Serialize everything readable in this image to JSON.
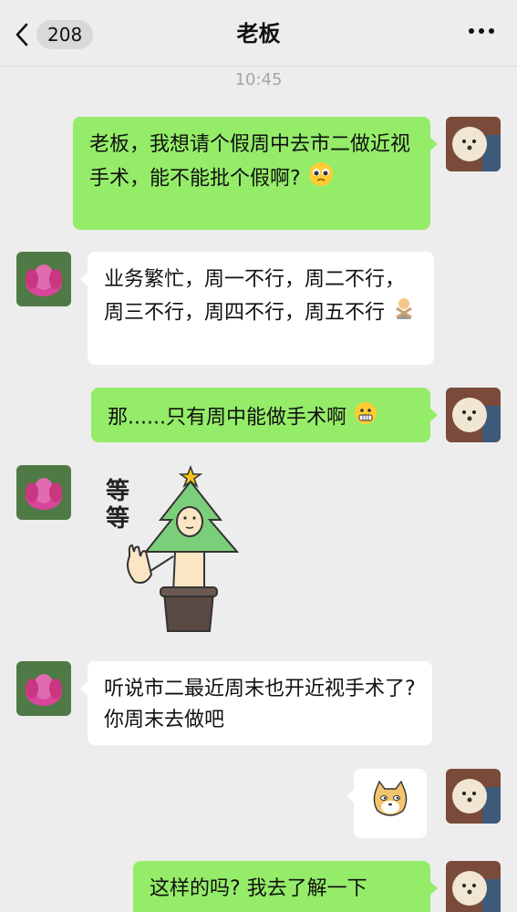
{
  "header": {
    "unread_count": "208",
    "title": "老板"
  },
  "timestamp": "10:45",
  "messages": [
    {
      "from": "me",
      "text": "老板，我想请个假周中去市二做近视手术，能不能批个假啊?",
      "emoji": "pleading-face"
    },
    {
      "from": "boss",
      "text": "业务繁忙，周一不行，周二不行，周三不行，周四不行，周五不行",
      "emoji": "person-gesturing-no"
    },
    {
      "from": "me",
      "text": "那......只有周中能做手术啊",
      "emoji": "grimace-face"
    },
    {
      "from": "boss",
      "sticker": "tree-person-wait",
      "sticker_text": "等等"
    },
    {
      "from": "boss",
      "text": "听说市二最近周末也开近视手术了? 你周末去做吧"
    },
    {
      "from": "me",
      "sticker": "doge-cat-face"
    },
    {
      "from": "me",
      "text": "这样的吗? 我去了解一下"
    }
  ],
  "colors": {
    "outgoing_bubble": "#95ec69",
    "incoming_bubble": "#ffffff",
    "background": "#ededed"
  }
}
